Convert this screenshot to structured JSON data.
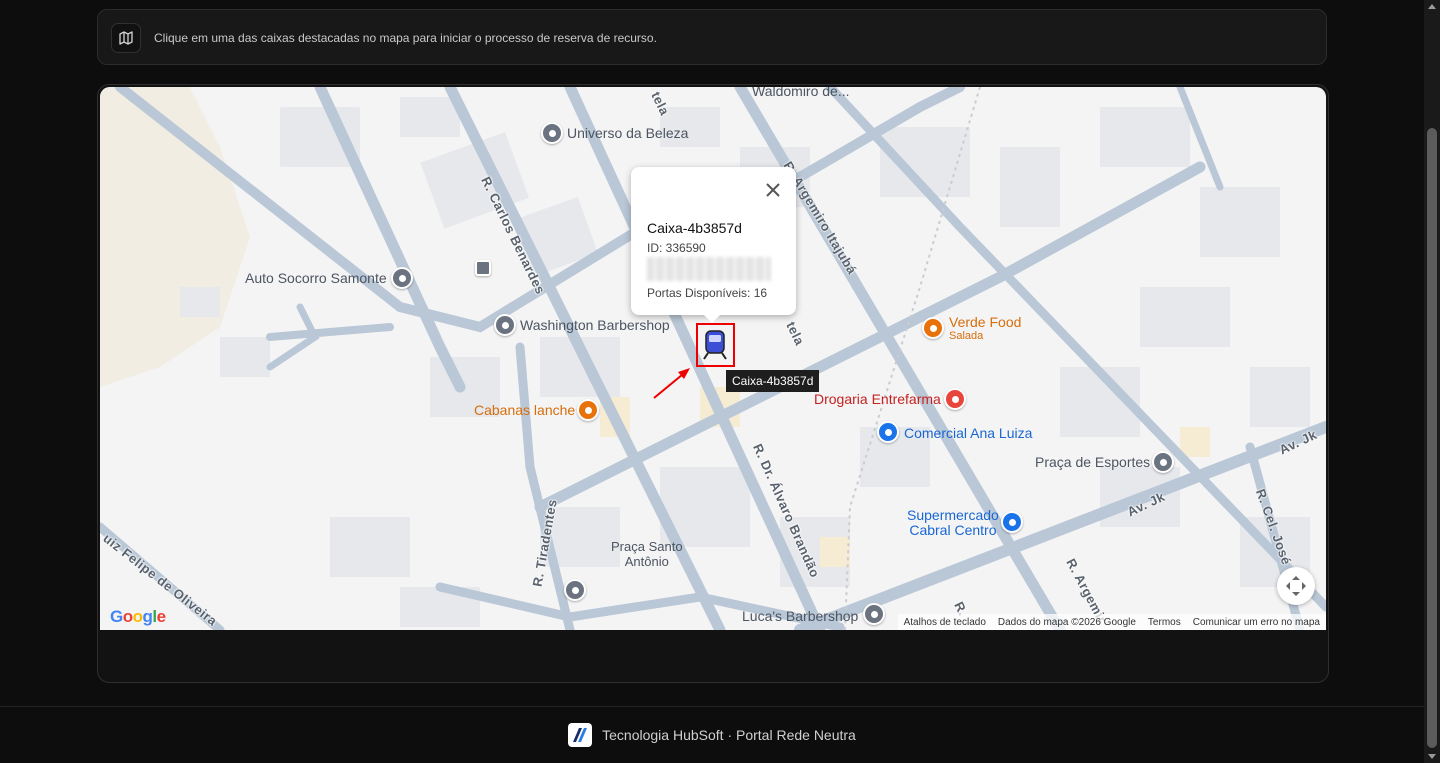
{
  "banner": {
    "icon": "map-icon",
    "text": "Clique em uma das caixas destacadas no mapa para iniciar o processo de reserva de recurso."
  },
  "map": {
    "popup": {
      "title": "Caixa-4b3857d",
      "id_line": "ID: 336590",
      "ports_line": "Portas Disponíveis: 16"
    },
    "tooltip": "Caixa-4b3857d",
    "pois": {
      "universo": "Universo da Beleza",
      "auto_socorro": "Auto Socorro Samonte",
      "washington": "Washington Barbershop",
      "cabanas": "Cabanas lanche",
      "verde_food": "Verde Food",
      "verde_food_sub": "Salada",
      "drogaria": "Drogaria Entrefarma",
      "comercial": "Comercial Ana Luiza",
      "praca_esportes": "Praça de Esportes",
      "supermercado_1": "Supermercado",
      "supermercado_2": "Cabral Centro",
      "praca_santo_1": "Praça Santo",
      "praca_santo_2": "Antônio",
      "lucas": "Luca's Barbershop",
      "waldomiro": "Waldomiro de..."
    },
    "streets": {
      "carlos": "R. Carlos Benardes",
      "argemiro": "R. Argemiro Itajubá",
      "alvaro": "R. Dr. Álvaro Brandão",
      "tiradentes": "R. Tiradentes",
      "luiz": "uiz Felipe de Oliveira",
      "avjk1": "Av. Jk",
      "avjk2": "Av. Jk",
      "cel": "R. Cel. José",
      "argemiro2": "R. Argemir",
      "tela1": "tela",
      "tela2": "tela",
      "r_small": "R."
    },
    "attribution": {
      "shortcuts": "Atalhos de teclado",
      "data": "Dados do mapa ©2026 Google",
      "terms": "Termos",
      "report": "Comunicar um erro no mapa"
    },
    "logo": "Google"
  },
  "footer": {
    "text": "Tecnologia HubSoft · Portal Rede Neutra"
  }
}
